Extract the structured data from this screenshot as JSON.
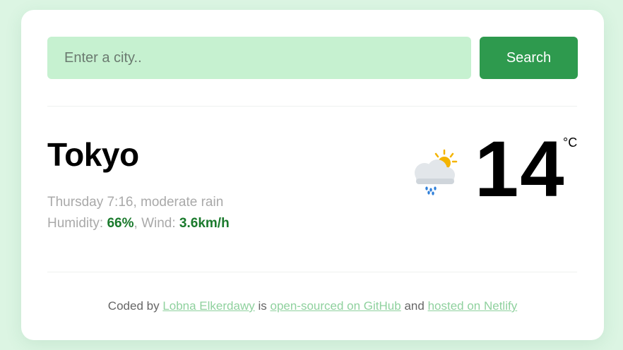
{
  "search": {
    "placeholder": "Enter a city..",
    "button_label": "Search"
  },
  "weather": {
    "city": "Tokyo",
    "datetime": "Thursday 7:16",
    "description": "moderate rain",
    "humidity_label": "Humidity:",
    "humidity_value": "66%",
    "wind_label": "Wind:",
    "wind_value": "3.6km/h",
    "temperature": "14",
    "unit": "°C",
    "icon": "rain-cloud-sun-icon"
  },
  "footer": {
    "prefix": "Coded by",
    "author_link": "Lobna Elkerdawy",
    "mid1": "is",
    "github_link": "open-sourced on GitHub",
    "mid2": "and",
    "netlify_link": "hosted on Netlify"
  },
  "colors": {
    "page_bg": "#dcf5e3",
    "input_bg": "#c6f1d0",
    "button_bg": "#2e9a4e",
    "value_green": "#1a7a2c",
    "link_green": "#8fd19e"
  }
}
